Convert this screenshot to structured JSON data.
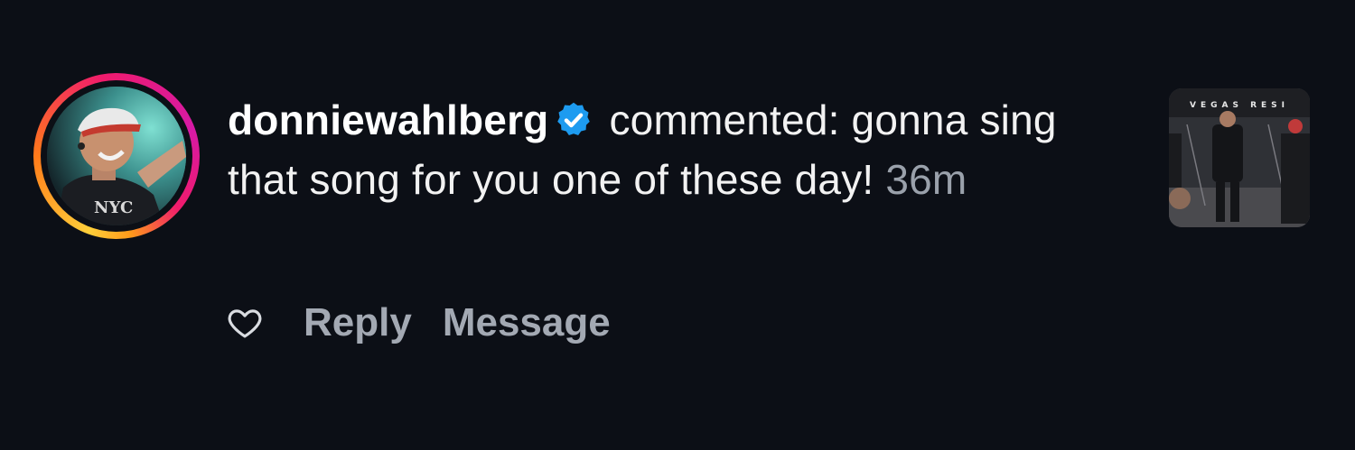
{
  "comment": {
    "username": "donniewahlberg",
    "action_text": " commented: gonna sing that song for you one of these day! ",
    "timestamp": "36m"
  },
  "actions": {
    "reply_label": "Reply",
    "message_label": "Message"
  },
  "thumbnail": {
    "banner_text": "VEGAS RESI"
  },
  "colors": {
    "background": "#0c0f16",
    "verified_badge": "#1d9bf0",
    "muted_text": "#9aa1ab"
  },
  "icons": {
    "verified": "verified-badge-icon",
    "like": "heart-outline-icon"
  }
}
